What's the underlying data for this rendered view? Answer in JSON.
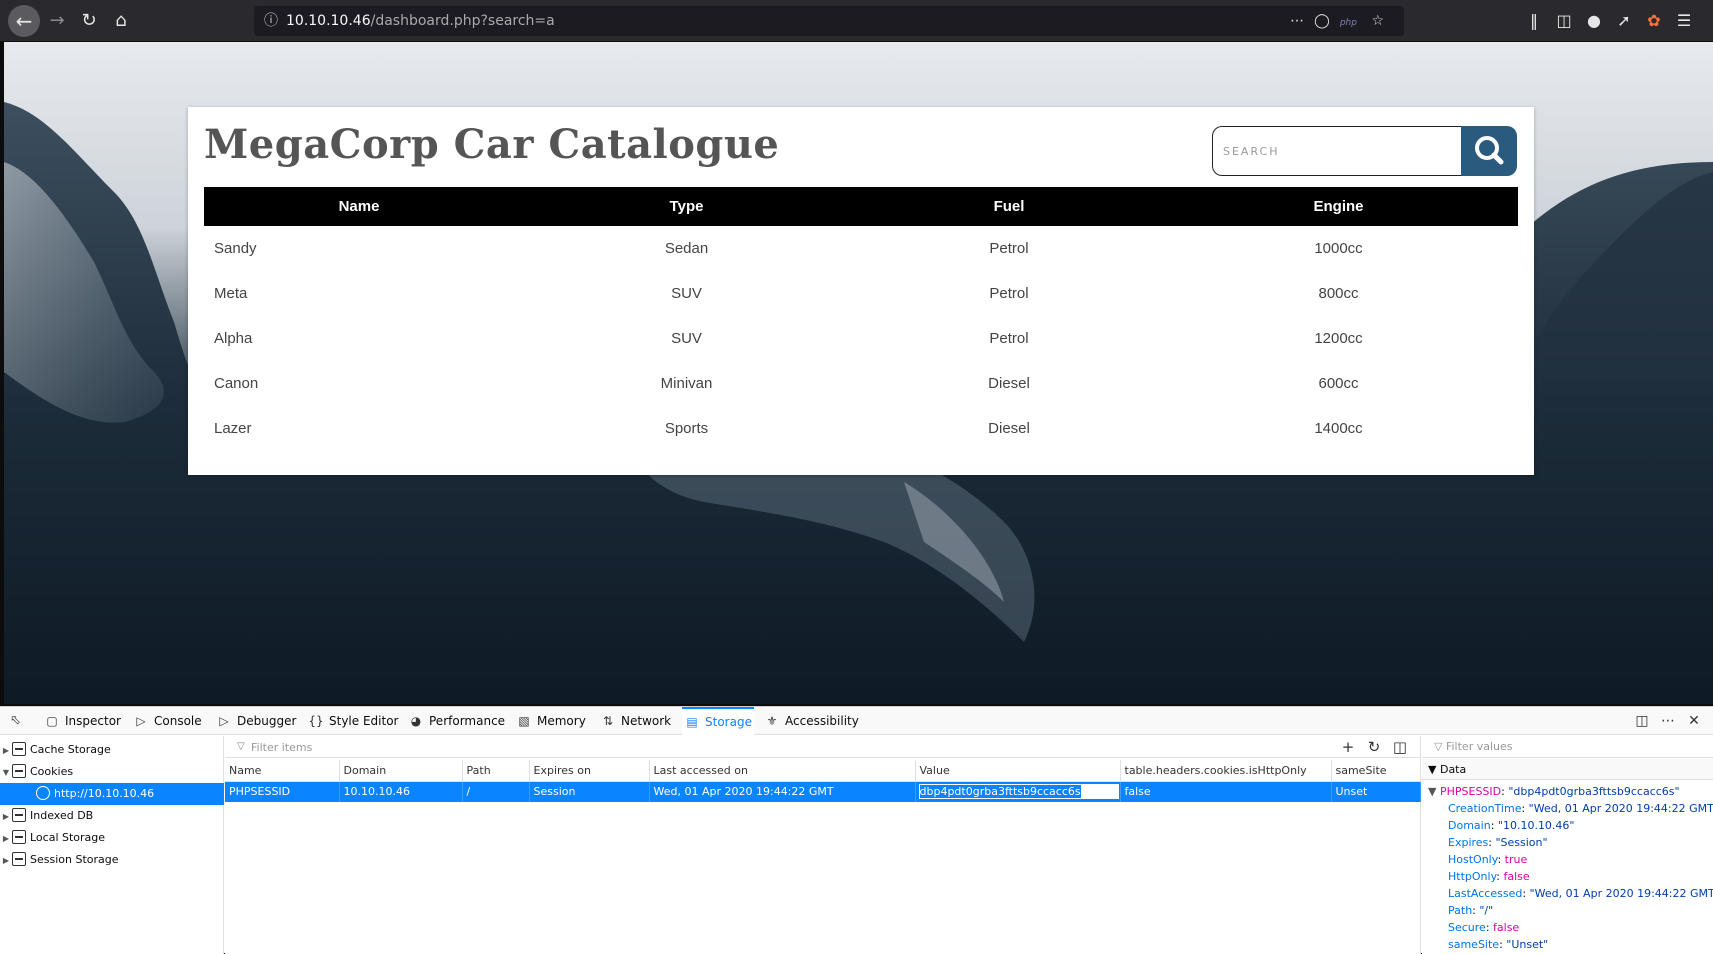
{
  "browser": {
    "url_host": "10.10.10.46",
    "url_path": "/dashboard.php?search=a"
  },
  "page": {
    "title": "MegaCorp Car Catalogue",
    "search_placeholder": "SEARCH",
    "table": {
      "headers": [
        "Name",
        "Type",
        "Fuel",
        "Engine"
      ],
      "rows": [
        [
          "Sandy",
          "Sedan",
          "Petrol",
          "1000cc"
        ],
        [
          "Meta",
          "SUV",
          "Petrol",
          "800cc"
        ],
        [
          "Alpha",
          "SUV",
          "Petrol",
          "1200cc"
        ],
        [
          "Canon",
          "Minivan",
          "Diesel",
          "600cc"
        ],
        [
          "Lazer",
          "Sports",
          "Diesel",
          "1400cc"
        ]
      ]
    }
  },
  "devtools": {
    "tabs": [
      "Inspector",
      "Console",
      "Debugger",
      "Style Editor",
      "Performance",
      "Memory",
      "Network",
      "Storage",
      "Accessibility"
    ],
    "active_tab": "Storage",
    "sidebar": {
      "items": [
        "Cache Storage",
        "Cookies",
        "http://10.10.10.46",
        "Indexed DB",
        "Local Storage",
        "Session Storage"
      ]
    },
    "filter_items_placeholder": "Filter items",
    "filter_values_placeholder": "Filter values",
    "cookie_table": {
      "headers": [
        "Name",
        "Domain",
        "Path",
        "Expires on",
        "Last accessed on",
        "Value",
        "table.headers.cookies.isHttpOnly",
        "sameSite"
      ],
      "row": [
        "PHPSESSID",
        "10.10.10.46",
        "/",
        "Session",
        "Wed, 01 Apr 2020 19:44:22 GMT",
        "dbp4pdt0grba3fttsb9ccacc6s",
        "false",
        "Unset"
      ]
    },
    "data_panel": {
      "header": "Data",
      "root_key": "PHPSESSID",
      "root_value": "\"dbp4pdt0grba3fttsb9ccacc6s\"",
      "fields": [
        {
          "key": "CreationTime",
          "value": "\"Wed, 01 Apr 2020 19:44:22 GMT\""
        },
        {
          "key": "Domain",
          "value": "\"10.10.10.46\""
        },
        {
          "key": "Expires",
          "value": "\"Session\""
        },
        {
          "key": "HostOnly",
          "value": "true"
        },
        {
          "key": "HttpOnly",
          "value": "false"
        },
        {
          "key": "LastAccessed",
          "value": "\"Wed, 01 Apr 2020 19:44:22 GMT\""
        },
        {
          "key": "Path",
          "value": "\"/\""
        },
        {
          "key": "Secure",
          "value": "false"
        },
        {
          "key": "sameSite",
          "value": "\"Unset\""
        }
      ]
    }
  }
}
